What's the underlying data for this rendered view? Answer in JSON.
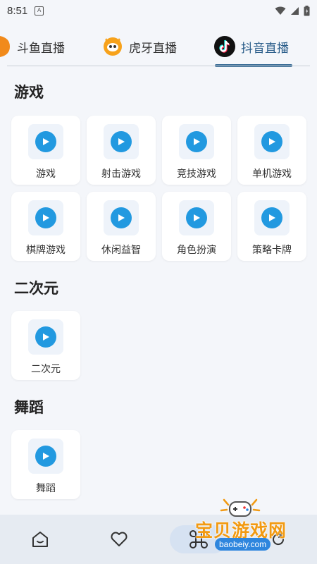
{
  "status": {
    "time": "8:51",
    "app_badge": "A"
  },
  "tabs": [
    {
      "label": "斗鱼直播",
      "icon": "douyu-logo-icon",
      "active": false
    },
    {
      "label": "虎牙直播",
      "icon": "huya-logo-icon",
      "active": false
    },
    {
      "label": "抖音直播",
      "icon": "douyin-logo-icon",
      "active": true
    }
  ],
  "sections": [
    {
      "title": "游戏",
      "items": [
        "游戏",
        "射击游戏",
        "竞技游戏",
        "单机游戏",
        "棋牌游戏",
        "休闲益智",
        "角色扮演",
        "策略卡牌"
      ]
    },
    {
      "title": "二次元",
      "items": [
        "二次元"
      ]
    },
    {
      "title": "舞蹈",
      "items": [
        "舞蹈"
      ]
    }
  ],
  "bottom_nav": [
    {
      "icon": "home-icon",
      "active": false
    },
    {
      "icon": "heart-icon",
      "active": false
    },
    {
      "icon": "apps-icon",
      "active": true
    },
    {
      "icon": "refresh-icon",
      "active": false
    }
  ],
  "watermark": {
    "title": "宝贝游戏网",
    "url": "baobeiy.com"
  },
  "colors": {
    "accent": "#2299e0",
    "active_tab": "#2a5d8a",
    "watermark": "#f29a12"
  }
}
